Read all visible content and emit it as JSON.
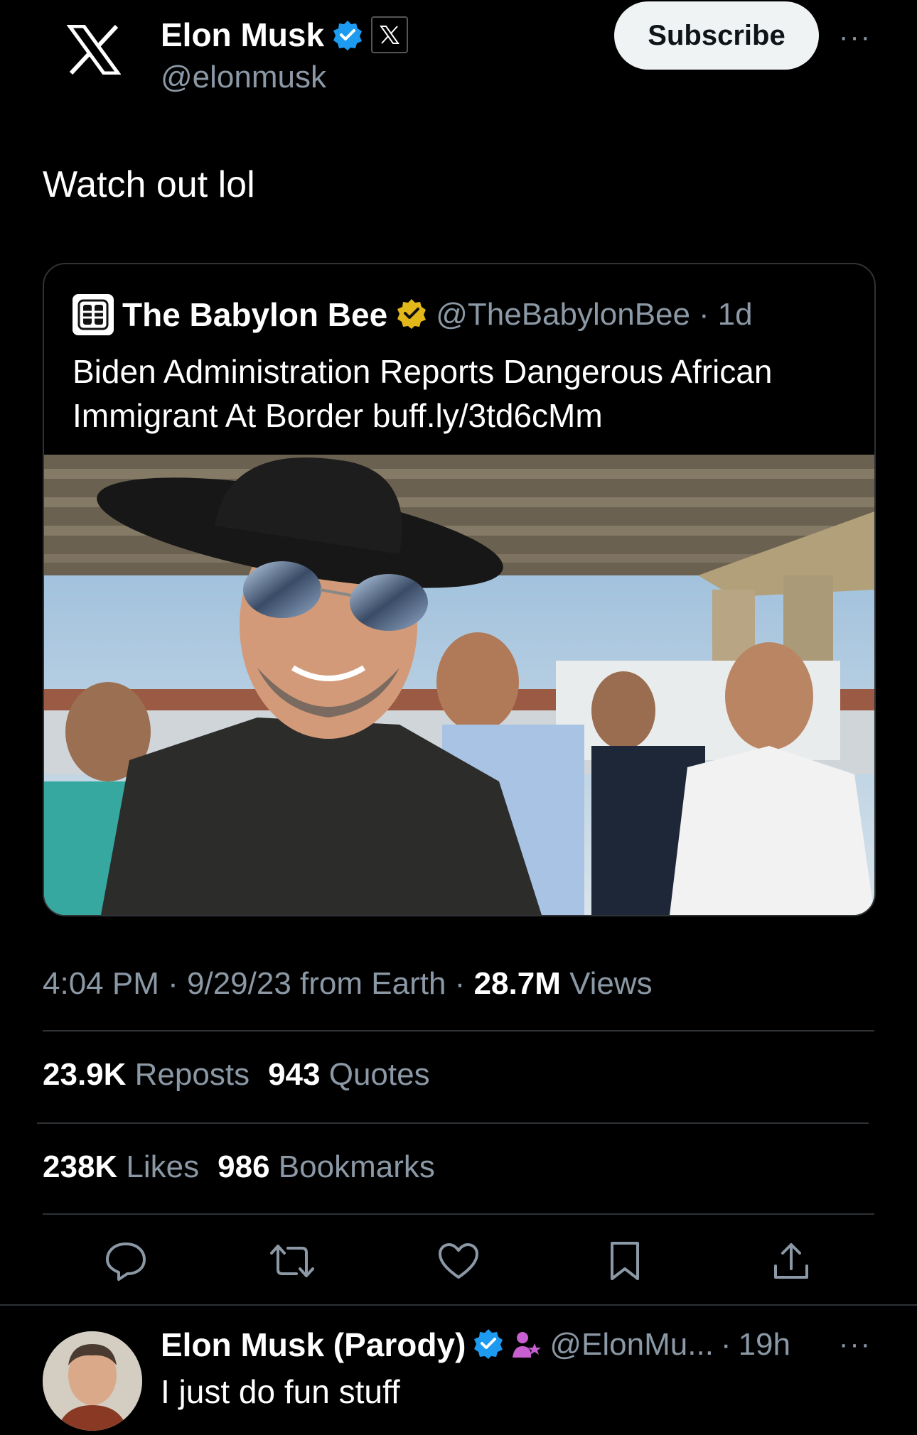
{
  "header": {
    "display_name": "Elon Musk",
    "handle": "@elonmusk",
    "subscribe_label": "Subscribe",
    "more_label": "···",
    "verified_color": "#1d9bf0",
    "logo_icon": "x-logo-icon"
  },
  "tweet": {
    "text": "Watch out lol"
  },
  "quote": {
    "name": "The Babylon Bee",
    "handle": "@TheBabylonBee",
    "sep": "·",
    "age": "1d",
    "text": "Biden Administration Reports Dangerous African Immigrant At Border buff.ly/3td6cMm",
    "badge_color": "#e2b719"
  },
  "meta": {
    "time": "4:04 PM",
    "date": "9/29/23",
    "source": "from Earth",
    "views_count": "28.7M",
    "views_label": "Views",
    "sep": "·"
  },
  "stats": {
    "reposts_count": "23.9K",
    "reposts_label": "Reposts",
    "quotes_count": "943",
    "quotes_label": "Quotes",
    "likes_count": "238K",
    "likes_label": "Likes",
    "bookmarks_count": "986",
    "bookmarks_label": "Bookmarks"
  },
  "actions": [
    "reply-icon",
    "repost-icon",
    "like-icon",
    "bookmark-icon",
    "share-icon"
  ],
  "reply": {
    "name": "Elon Musk (Parody)",
    "handle": "@ElonMu...",
    "sep": "·",
    "age": "19h",
    "text": "I just do fun stuff",
    "more_label": "···"
  }
}
